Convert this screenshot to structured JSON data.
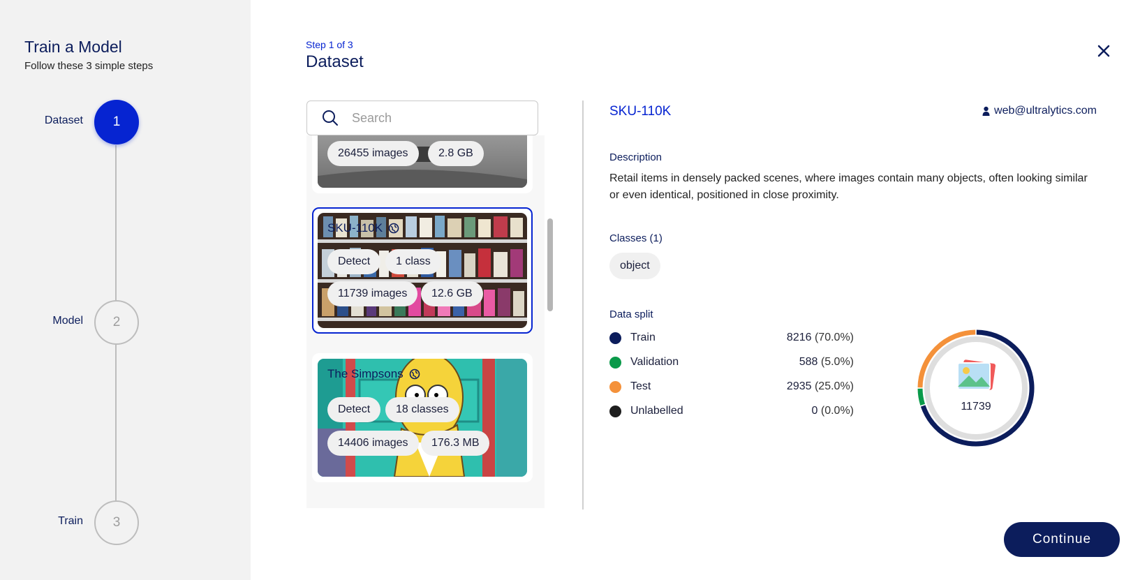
{
  "sidebar": {
    "title": "Train a Model",
    "subtitle": "Follow these 3 simple steps",
    "steps": [
      {
        "label": "Dataset",
        "number": "1",
        "active": true
      },
      {
        "label": "Model",
        "number": "2",
        "active": false
      },
      {
        "label": "Train",
        "number": "3",
        "active": false
      }
    ]
  },
  "header": {
    "step_count": "Step 1 of 3",
    "title": "Dataset"
  },
  "search": {
    "placeholder": "Search",
    "value": ""
  },
  "datasets": [
    {
      "name": "",
      "chips": [
        "26455 images",
        "2.8 GB"
      ]
    },
    {
      "name": "SKU-110K",
      "task": "Detect",
      "classes": "1 class",
      "images": "11739 images",
      "size": "12.6 GB",
      "selected": true
    },
    {
      "name": "The Simpsons",
      "task": "Detect",
      "classes": "18 classes",
      "images": "14406 images",
      "size": "176.3 MB",
      "selected": false
    }
  ],
  "details": {
    "name": "SKU-110K",
    "owner": "web@ultralytics.com",
    "description_label": "Description",
    "description": "Retail items in densely packed scenes, where images contain many objects, often looking similar or even identical, positioned in close proximity.",
    "classes_label": "Classes (1)",
    "classes": [
      "object"
    ],
    "split_label": "Data split",
    "split": [
      {
        "name": "Train",
        "count": "8216",
        "pct": "(70.0%)",
        "color": "#0c1d5c",
        "fraction": 0.7
      },
      {
        "name": "Validation",
        "count": "588",
        "pct": "(5.0%)",
        "color": "#0a9a4a",
        "fraction": 0.05
      },
      {
        "name": "Test",
        "count": "2935",
        "pct": "(25.0%)",
        "color": "#f4913a",
        "fraction": 0.25
      },
      {
        "name": "Unlabelled",
        "count": "0",
        "pct": "(0.0%)",
        "color": "#1e1e1e",
        "fraction": 0.0
      }
    ],
    "total": "11739"
  },
  "actions": {
    "continue_label": "Continue"
  }
}
